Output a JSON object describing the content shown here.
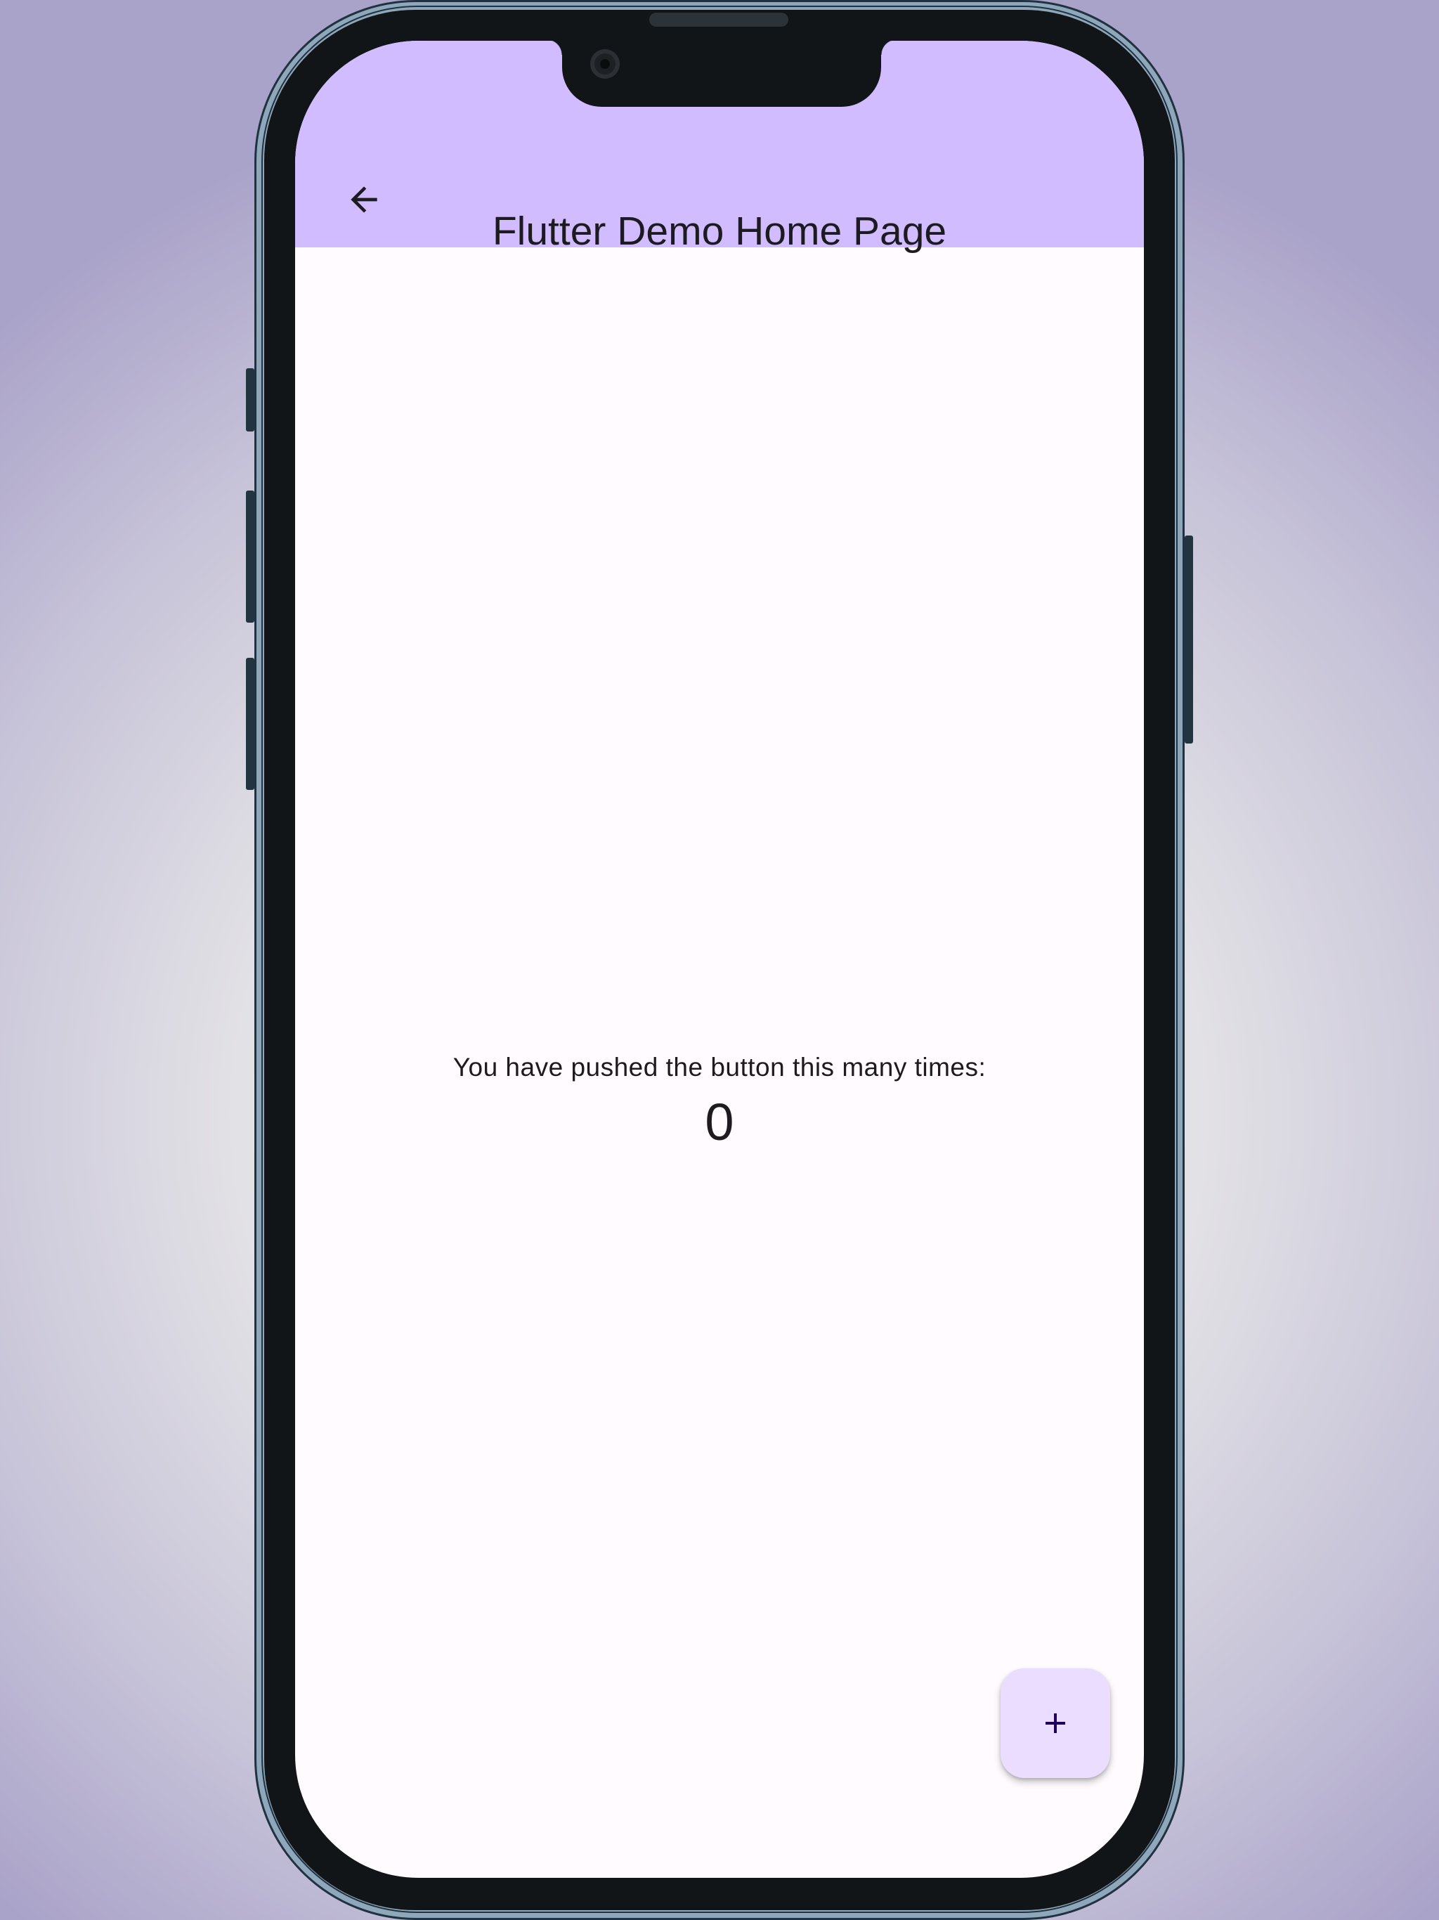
{
  "app_bar": {
    "title": "Flutter Demo Home Page",
    "back_icon": "arrow-back-icon",
    "background_color": "#d0bcff"
  },
  "body": {
    "counter_label": "You have pushed the button this many times:",
    "counter_value": "0"
  },
  "fab": {
    "icon": "plus-icon",
    "background_color": "#eaddff",
    "icon_color": "#21005d"
  }
}
